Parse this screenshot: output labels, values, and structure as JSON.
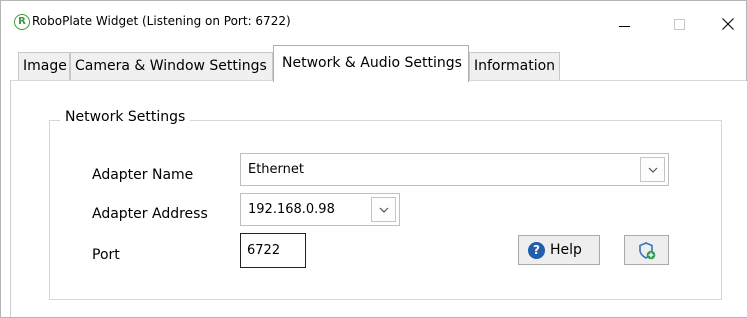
{
  "window": {
    "title": "RoboPlate Widget (Listening on  Port: 6722)",
    "app_icon_letter": "R"
  },
  "tabs": [
    {
      "label": "Image",
      "active": false
    },
    {
      "label": "Camera & Window Settings",
      "active": false
    },
    {
      "label": "Network & Audio Settings",
      "active": true
    },
    {
      "label": "Information",
      "active": false
    }
  ],
  "network_settings": {
    "group_title": "Network Settings",
    "adapter_name": {
      "label": "Adapter Name",
      "value": "Ethernet"
    },
    "adapter_address": {
      "label": "Adapter Address",
      "value": "192.168.0.98"
    },
    "port": {
      "label": "Port",
      "value": "6722"
    },
    "help_button": {
      "label": "Help",
      "icon": "question-icon"
    },
    "shield_button": {
      "icon": "shield-add-icon"
    }
  },
  "colors": {
    "app_icon": "#3a9a3a",
    "help_icon": "#1f5fae",
    "shield_icon": "#3a74b8"
  }
}
